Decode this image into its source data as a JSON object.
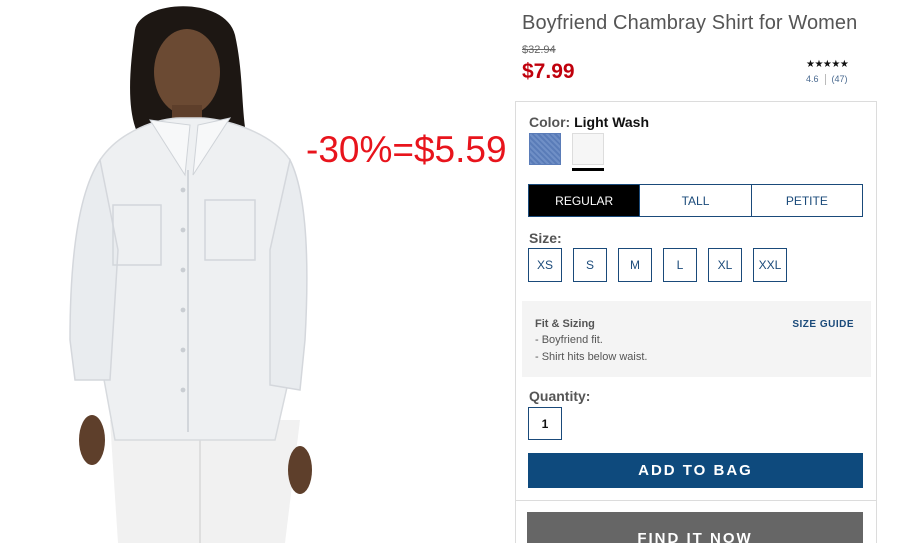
{
  "product": {
    "title": "Boyfriend Chambray Shirt for Women",
    "was_price": "$32.94",
    "sale_price": "$7.99",
    "stars": "★★★★★",
    "rating": "4.6",
    "review_count": "(47)"
  },
  "promo_overlay": "-30%=$5.59",
  "color": {
    "label": "Color:",
    "selected": "Light Wash",
    "swatches": [
      "chambray-blue-swatch",
      "light-wash-swatch"
    ]
  },
  "fit_tabs": [
    "REGULAR",
    "TALL",
    "PETITE"
  ],
  "size": {
    "label": "Size:",
    "options": [
      "XS",
      "S",
      "M",
      "L",
      "XL",
      "XXL"
    ]
  },
  "fit_sizing": {
    "title": "Fit & Sizing",
    "guide_link": "SIZE GUIDE",
    "notes": [
      "- Boyfriend fit.",
      "- Shirt hits below waist."
    ]
  },
  "quantity": {
    "label": "Quantity:",
    "value": "1"
  },
  "buttons": {
    "add_to_bag": "ADD TO BAG",
    "find_it_now": "FIND IT NOW"
  },
  "colors": {
    "promo_red": "#e8141c",
    "sale_red": "#c0000c",
    "navy": "#0e4a7d",
    "gray_button": "#666666"
  }
}
